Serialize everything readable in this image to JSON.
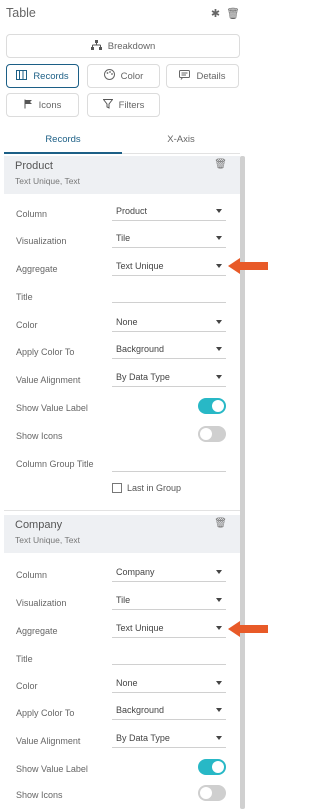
{
  "header": {
    "title": "Table"
  },
  "buttons": {
    "breakdown": "Breakdown",
    "records": "Records",
    "color": "Color",
    "details": "Details",
    "icons": "Icons",
    "filters": "Filters"
  },
  "tabs": [
    "Records",
    "X-Axis"
  ],
  "labels": {
    "column": "Column",
    "visualization": "Visualization",
    "aggregate": "Aggregate",
    "title": "Title",
    "color": "Color",
    "apply_color_to": "Apply Color To",
    "value_alignment": "Value Alignment",
    "show_value_label": "Show Value Label",
    "show_icons": "Show Icons",
    "column_group_title": "Column Group Title",
    "last_in_group": "Last in Group"
  },
  "sections": [
    {
      "name": "Product",
      "subtitle": "Text Unique, Text",
      "column": "Product",
      "visualization": "Tile",
      "aggregate": "Text Unique",
      "title": "",
      "color": "None",
      "apply_color_to": "Background",
      "value_alignment": "By Data Type",
      "show_value_label": true,
      "show_icons": false,
      "column_group_title": "",
      "last_in_group": false
    },
    {
      "name": "Company",
      "subtitle": "Text Unique, Text",
      "column": "Company",
      "visualization": "Tile",
      "aggregate": "Text Unique",
      "title": "",
      "color": "None",
      "apply_color_to": "Background",
      "value_alignment": "By Data Type",
      "show_value_label": true,
      "show_icons": false
    }
  ],
  "colors": {
    "accent": "#1c5f86",
    "toggle_on": "#28b8c6",
    "callout_arrow": "#e85a28"
  }
}
